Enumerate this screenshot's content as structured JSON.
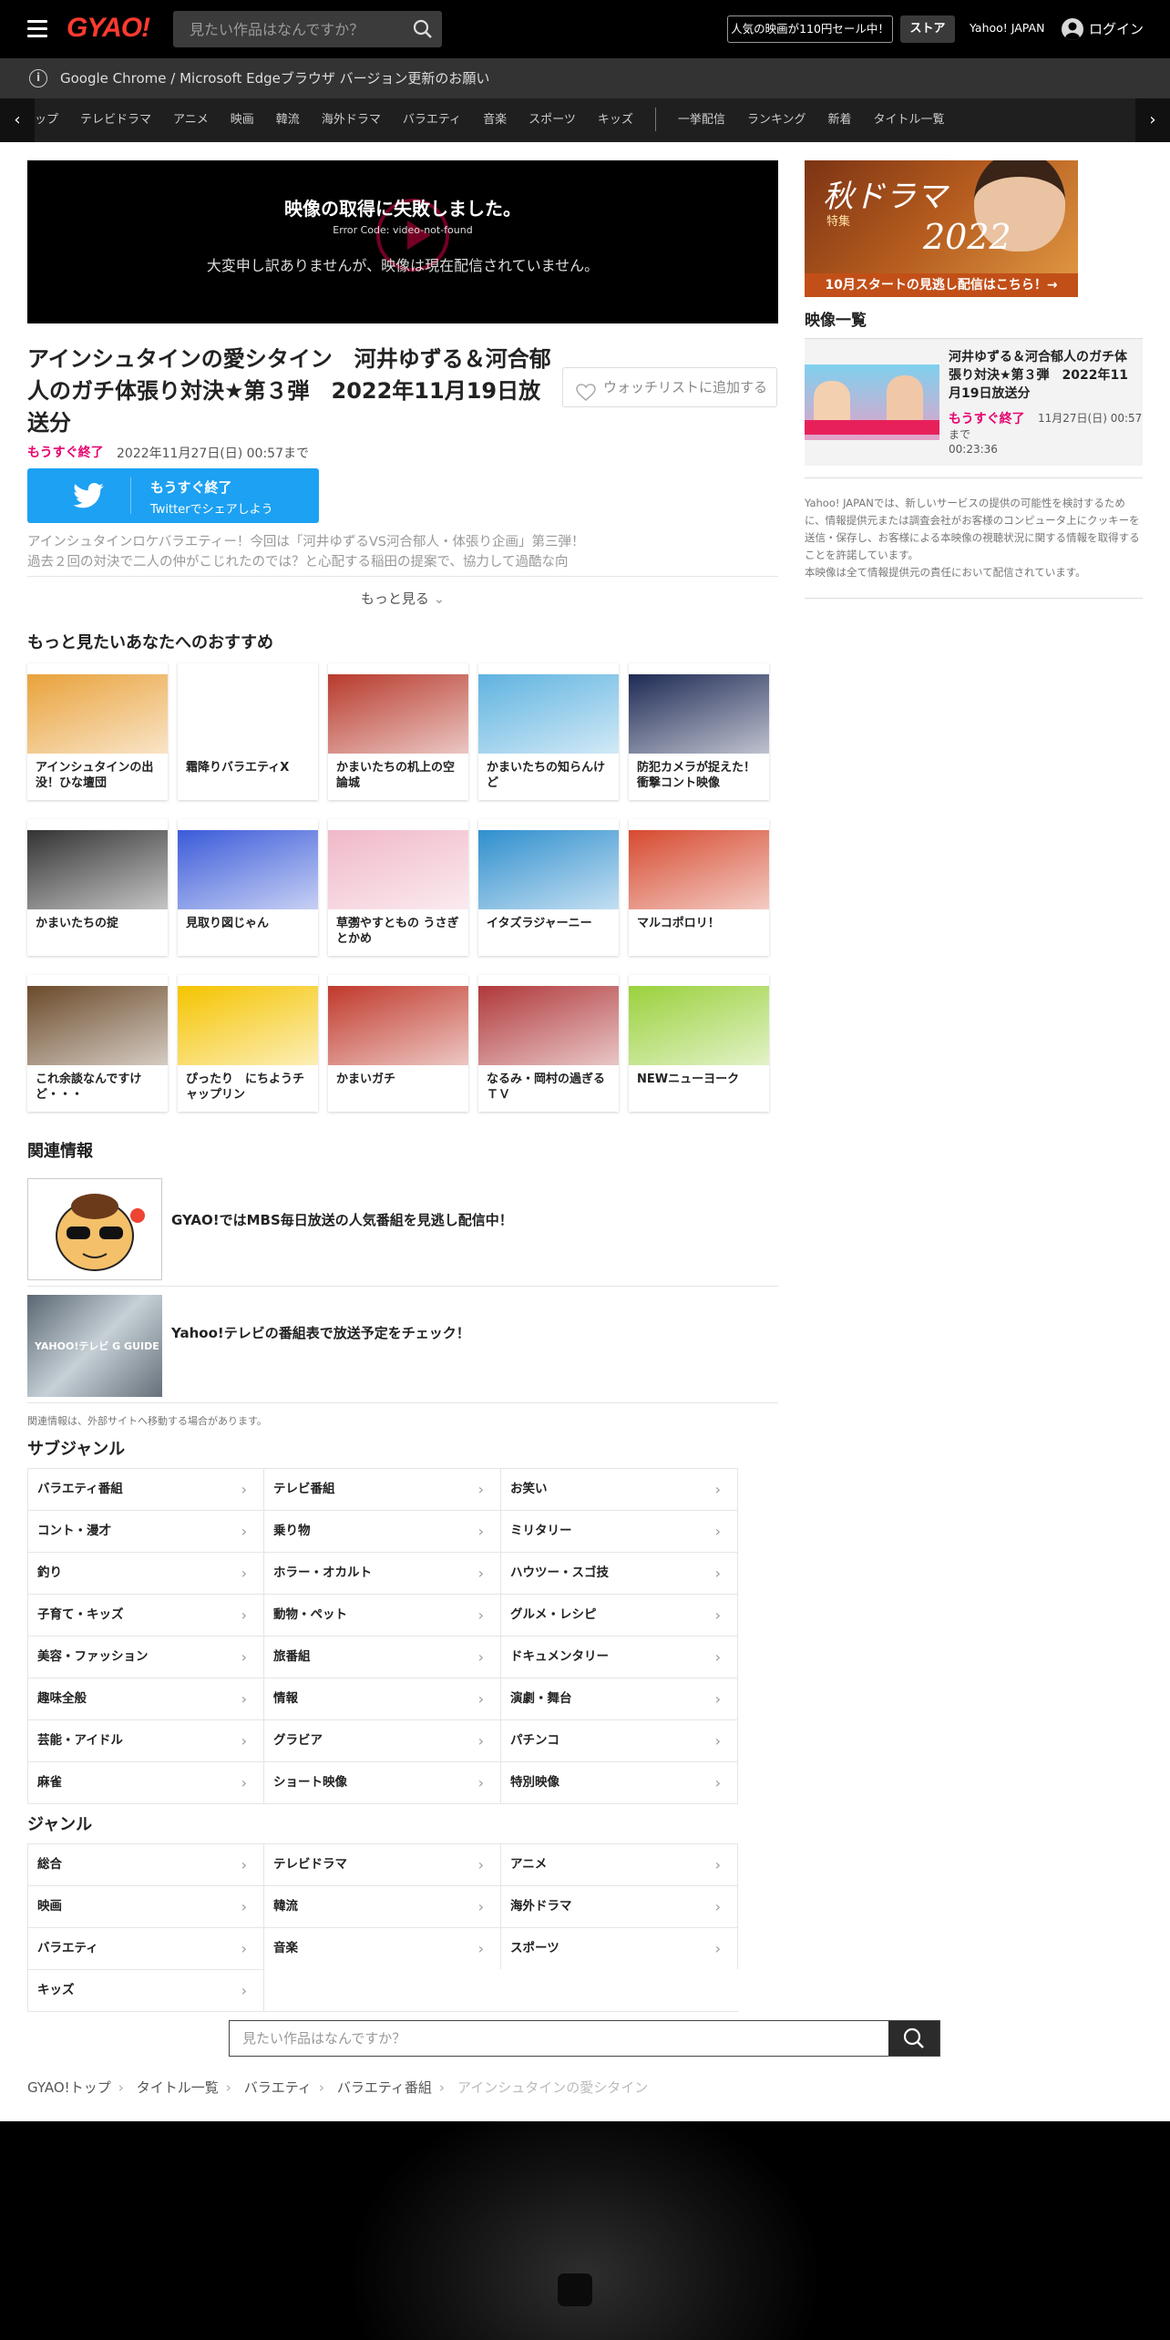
{
  "header": {
    "logo": "GYAO!",
    "search_placeholder": "見たい作品はなんですか？",
    "sale_label": "人気の映画が110円セール中！",
    "store_label": "ストア",
    "yahoo_label": "Yahoo! JAPAN",
    "login_label": "ログイン"
  },
  "notice": {
    "text": "Google Chrome / Microsoft Edgeブラウザ バージョン更新のお願い"
  },
  "genre_nav": {
    "items_before_sep": [
      "ップ",
      "テレビドラマ",
      "アニメ",
      "映画",
      "韓流",
      "海外ドラマ",
      "バラエティ",
      "音楽",
      "スポーツ",
      "キッズ"
    ],
    "items_after_sep": [
      "一挙配信",
      "ランキング",
      "新着",
      "タイトル一覧"
    ]
  },
  "player": {
    "error_title": "映像の取得に失敗しました。",
    "error_code": "Error Code: video-not-found",
    "error_message": "大変申し訳ありませんが、映像は現在配信されていません。"
  },
  "program": {
    "title": "アインシュタインの愛シタイン　河井ゆずる＆河合郁人のガチ体張り対決★第３弾　2022年11月19日放送分",
    "watchlist_label": "ウォッチリストに追加する",
    "ending_tag": "もうすぐ終了",
    "ending_date": "2022年11月27日(日) 00:57まで",
    "twitter_line1": "もうすぐ終了",
    "twitter_line2": "Twitterでシェアしよう",
    "description_line1": "アインシュタインロケバラエティー！今回は「河井ゆずるVS河合郁人・体張り企画」第三弾！",
    "description_line2": "過去２回の対決で二人の仲がこじれたのでは？と心配する稲田の提案で、協力して過酷な向",
    "more_label": "もっと見る"
  },
  "recommend": {
    "heading": "もっと見たいあなたへのおすすめ",
    "items": [
      {
        "title": "アインシュタインの出没！ひな壇団",
        "color": "#e9a23b"
      },
      {
        "title": "霜降りバラエティX",
        "color": "#ffffff"
      },
      {
        "title": "かまいたちの机上の空論城",
        "color": "#b83a2c"
      },
      {
        "title": "かまいたちの知らんけど",
        "color": "#5fb3e0"
      },
      {
        "title": "防犯カメラが捉えた！衝撃コント映像",
        "color": "#1e2a55"
      },
      {
        "title": "かまいたちの掟",
        "color": "#333333"
      },
      {
        "title": "見取り図じゃん",
        "color": "#3b5bd9"
      },
      {
        "title": "草彅やすともの うさぎとかめ",
        "color": "#f0b8c8"
      },
      {
        "title": "イタズラジャーニー",
        "color": "#2f8fce"
      },
      {
        "title": "マルコポロリ！",
        "color": "#d64a2f"
      },
      {
        "title": "これ余談なんですけど・・・",
        "color": "#6b4a2a"
      },
      {
        "title": "ぴったり　にちようチャップリン",
        "color": "#f5c400"
      },
      {
        "title": "かまいガチ",
        "color": "#c0392b"
      },
      {
        "title": "なるみ・岡村の過ぎるＴＶ",
        "color": "#b0383a"
      },
      {
        "title": "NEWニューヨーク",
        "color": "#9ad13c"
      }
    ]
  },
  "related": {
    "heading": "関連情報",
    "items": [
      {
        "text": "GYAO!ではMBS毎日放送の人気番組を見逃し配信中！"
      },
      {
        "text": "Yahoo!テレビの番組表で放送予定をチェック！"
      }
    ],
    "note": "関連情報は、外部サイトへ移動する場合があります。",
    "yahoo_tv_logo": "YAHOO!テレビ G GUIDE"
  },
  "subgenre": {
    "heading": "サブジャンル",
    "items": [
      "バラエティ番組",
      "テレビ番組",
      "お笑い",
      "コント・漫才",
      "乗り物",
      "ミリタリー",
      "釣り",
      "ホラー・オカルト",
      "ハウツー・スゴ技",
      "子育て・キッズ",
      "動物・ペット",
      "グルメ・レシピ",
      "美容・ファッション",
      "旅番組",
      "ドキュメンタリー",
      "趣味全般",
      "情報",
      "演劇・舞台",
      "芸能・アイドル",
      "グラビア",
      "パチンコ",
      "麻雀",
      "ショート映像",
      "特別映像"
    ]
  },
  "genre": {
    "heading": "ジャンル",
    "items": [
      "総合",
      "テレビドラマ",
      "アニメ",
      "映画",
      "韓流",
      "海外ドラマ",
      "バラエティ",
      "音楽",
      "スポーツ",
      "キッズ"
    ]
  },
  "bottom_search": {
    "placeholder": "見たい作品はなんですか？"
  },
  "breadcrumb": [
    "GYAO!トップ",
    "タイトル一覧",
    "バラエティ",
    "バラエティ番組",
    "アインシュタインの愛シタイン"
  ],
  "sidebar": {
    "banner": {
      "line1": "秋ドラマ",
      "line2": "特集",
      "line3": "2022",
      "cta": "10月スタートの見逃し配信はこちら！→"
    },
    "video_list_heading": "映像一覧",
    "video": {
      "title": "河井ゆずる＆河合郁人のガチ体張り対決★第３弾　2022年11月19日放送分",
      "ending_tag": "もうすぐ終了",
      "ending_date": "11月27日(日) 00:57",
      "made": "まで",
      "duration": "00:23:36"
    },
    "note": "Yahoo! JAPANでは、新しいサービスの提供の可能性を検討するために、情報提供元または調査会社がお客様のコンピュータ上にクッキーを送信・保存し、お客様による本映像の視聴状況に関する情報を取得することを許諾しています。\n本映像は全て情報提供元の責任において配信されています。"
  }
}
